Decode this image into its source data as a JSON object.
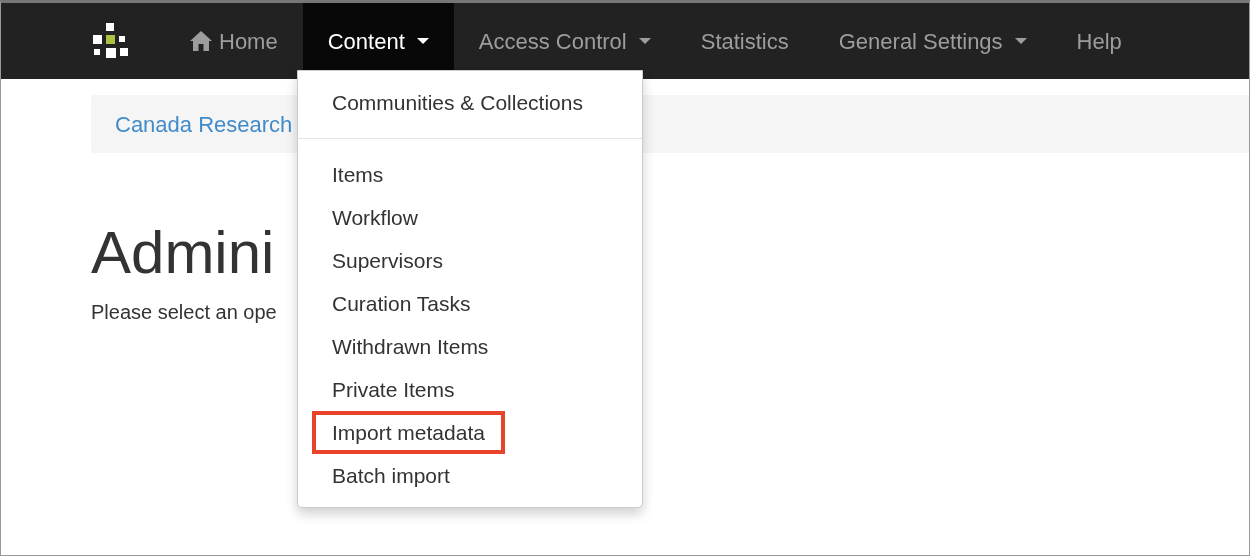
{
  "navbar": {
    "items": [
      {
        "label": "Home",
        "kind": "home",
        "selected": false,
        "dropdown": false
      },
      {
        "label": "Content",
        "kind": "link",
        "selected": true,
        "dropdown": true
      },
      {
        "label": "Access Control",
        "kind": "link",
        "selected": false,
        "dropdown": true
      },
      {
        "label": "Statistics",
        "kind": "link",
        "selected": false,
        "dropdown": false
      },
      {
        "label": "General Settings",
        "kind": "link",
        "selected": false,
        "dropdown": true
      },
      {
        "label": "Help",
        "kind": "link",
        "selected": false,
        "dropdown": false
      }
    ]
  },
  "breadcrumb": "Canada Research",
  "heading": "Admini",
  "intro": "Please select an ope",
  "dropdown_menu": {
    "groups": [
      [
        {
          "label": "Communities & Collections",
          "highlighted": false
        }
      ],
      [
        {
          "label": "Items",
          "highlighted": false
        },
        {
          "label": "Workflow",
          "highlighted": false
        },
        {
          "label": "Supervisors",
          "highlighted": false
        },
        {
          "label": "Curation Tasks",
          "highlighted": false
        },
        {
          "label": "Withdrawn Items",
          "highlighted": false
        },
        {
          "label": "Private Items",
          "highlighted": false
        },
        {
          "label": "Import metadata",
          "highlighted": true
        },
        {
          "label": "Batch import",
          "highlighted": false
        }
      ]
    ]
  }
}
